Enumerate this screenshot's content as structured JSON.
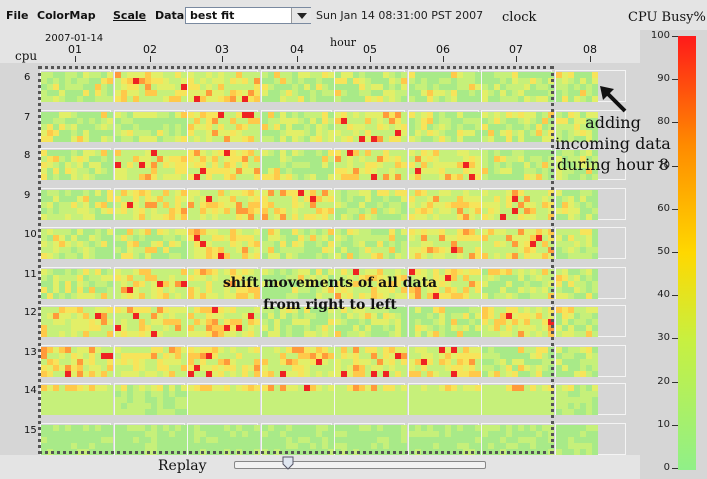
{
  "menu": {
    "items": [
      {
        "name": "menu-file",
        "label": "File"
      },
      {
        "name": "menu-colormap",
        "label": "ColorMap"
      },
      {
        "name": "menu-scale",
        "label": "Scale"
      },
      {
        "name": "menu-data",
        "label": "Data"
      }
    ],
    "fit_select_value": "best fit",
    "clock_time": "Sun Jan 14 08:31:00 PST 2007",
    "clock_label": "clock"
  },
  "axes": {
    "date": "2007-01-14",
    "hour_label": "hour",
    "cpu_label": "cpu",
    "hours": [
      "01",
      "02",
      "03",
      "04",
      "05",
      "06",
      "07",
      "08"
    ],
    "cpus": [
      "6",
      "7",
      "8",
      "9",
      "10",
      "11",
      "12",
      "13",
      "14",
      "15"
    ]
  },
  "colorbar": {
    "title": "CPU Busy%",
    "ticks": [
      "100",
      "90",
      "80",
      "70",
      "60",
      "50",
      "40",
      "30",
      "20",
      "10",
      "0"
    ],
    "colors": {
      "high": "#ff1a1a",
      "mid_high": "#ff8a00",
      "mid": "#ffd800",
      "low_mid": "#c8f040",
      "low": "#90f088"
    }
  },
  "annotations": {
    "shift_line1": "shift movements of all data",
    "shift_line2": "from right to left",
    "adding_line1": "adding",
    "adding_line2": "incoming data",
    "adding_line3": "during hour 8"
  },
  "footer": {
    "replay_label": "Replay",
    "replay_progress": 0.2
  },
  "heatmap": {
    "cell_background": "#a8ea88",
    "hot_spots": {
      "6": [
        1,
        2
      ],
      "7": [
        2,
        4
      ],
      "8": [
        1,
        2,
        4,
        5
      ],
      "9": [
        1,
        2,
        3,
        5,
        6
      ],
      "10": [
        2,
        5,
        6
      ],
      "11": [
        1,
        2,
        4,
        5
      ],
      "12": [
        0,
        1,
        2,
        6
      ],
      "13": [
        0,
        1,
        2,
        3,
        4,
        5
      ],
      "14": [
        0,
        2,
        3,
        4,
        5,
        6
      ],
      "15": []
    }
  }
}
